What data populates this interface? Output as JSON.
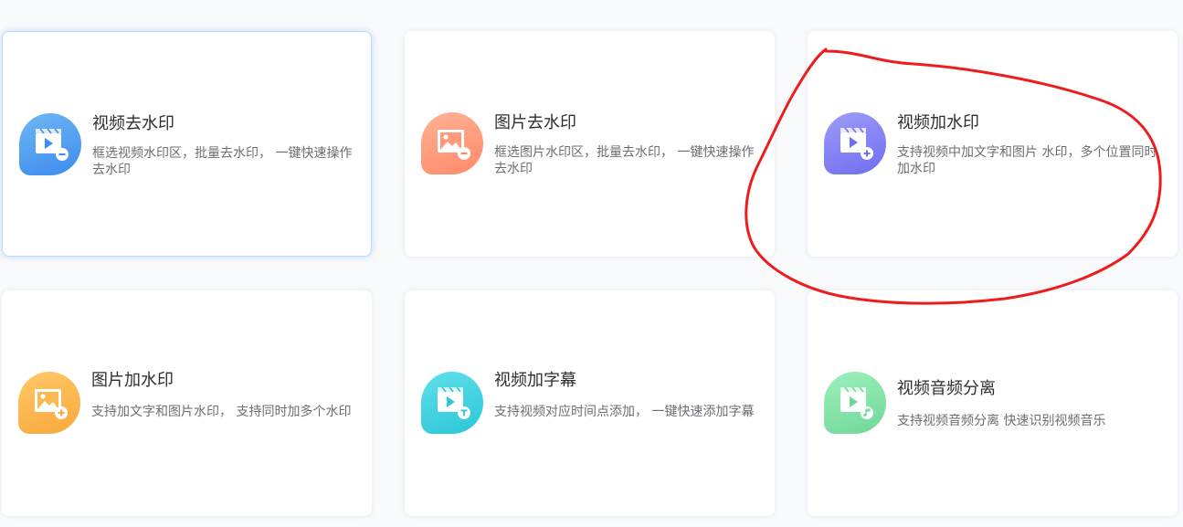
{
  "tools": [
    {
      "title": "视频去水印",
      "desc": "框选视频水印区，批量去水印， 一键快速操作去水印",
      "icon": "video-remove-icon",
      "colors": [
        "#6fb7f5",
        "#3d8bee"
      ]
    },
    {
      "title": "图片去水印",
      "desc": "框选图片水印区，批量去水印， 一键快速操作去水印",
      "icon": "image-remove-icon",
      "colors": [
        "#ffb294",
        "#ff8a6a"
      ]
    },
    {
      "title": "视频加水印",
      "desc": "支持视频中加文字和图片 水印，多个位置同时加水印",
      "icon": "video-add-icon",
      "colors": [
        "#9d9cf7",
        "#6f6ef0"
      ]
    },
    {
      "title": "图片加水印",
      "desc": "支持加文字和图片水印， 支持同时加多个水印",
      "icon": "image-add-icon",
      "colors": [
        "#ffc86a",
        "#f8a93a"
      ]
    },
    {
      "title": "视频加字幕",
      "desc": "支持视频对应时间点添加， 一键快速添加字幕",
      "icon": "video-subtitle-icon",
      "colors": [
        "#5fe0ea",
        "#2cc6d8"
      ]
    },
    {
      "title": "视频音频分离",
      "desc": "支持视频音频分离 快速识别视频音乐",
      "icon": "video-audio-icon",
      "colors": [
        "#9ef0bd",
        "#6fd898"
      ]
    }
  ],
  "annotation_color": "#ee1c1c"
}
